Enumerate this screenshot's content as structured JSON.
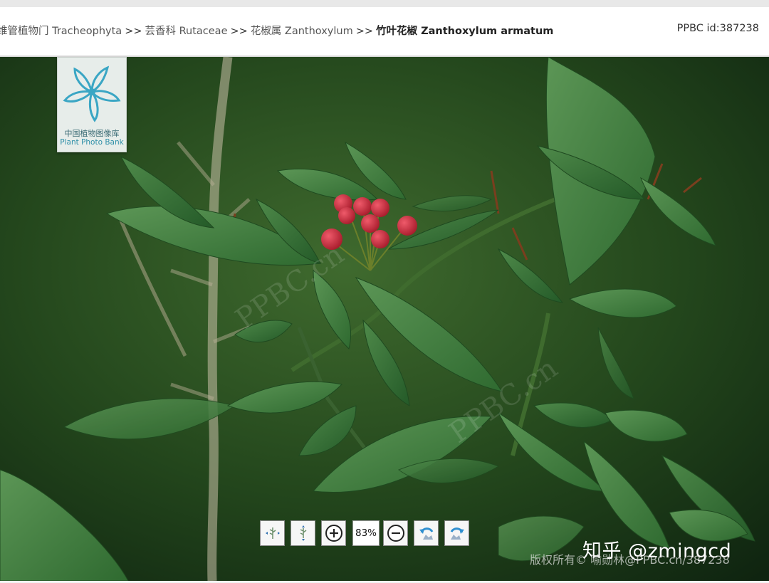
{
  "breadcrumb": {
    "items": [
      {
        "label": "维管植物门 Tracheophyta"
      },
      {
        "label": "芸香科 Rutaceae"
      },
      {
        "label": "花椒属 Zanthoxylum"
      },
      {
        "label": "竹叶花椒 Zanthoxylum armatum"
      }
    ],
    "separator": ">>"
  },
  "record_id": "PPBC id:387238",
  "logo": {
    "cn": "中国植物图像库",
    "en": "Plant Photo Bank"
  },
  "toolbar": {
    "zoom": "83%",
    "buttons": [
      {
        "icon": "fit-width-icon"
      },
      {
        "icon": "fit-height-icon"
      },
      {
        "icon": "zoom-in-icon"
      },
      {
        "icon": "zoom-out-icon"
      },
      {
        "icon": "rotate-left-icon"
      },
      {
        "icon": "rotate-right-icon"
      }
    ]
  },
  "overlay": {
    "zhihu": "知乎 @zmingcd",
    "copyright": "版权所有© 喻勋林@PPBC.cn/387238",
    "photo_watermark": "PPBC.cn"
  },
  "colors": {
    "berry": "#c8283a",
    "leaf": "#3f7d3a",
    "background": "#1e3a18"
  }
}
